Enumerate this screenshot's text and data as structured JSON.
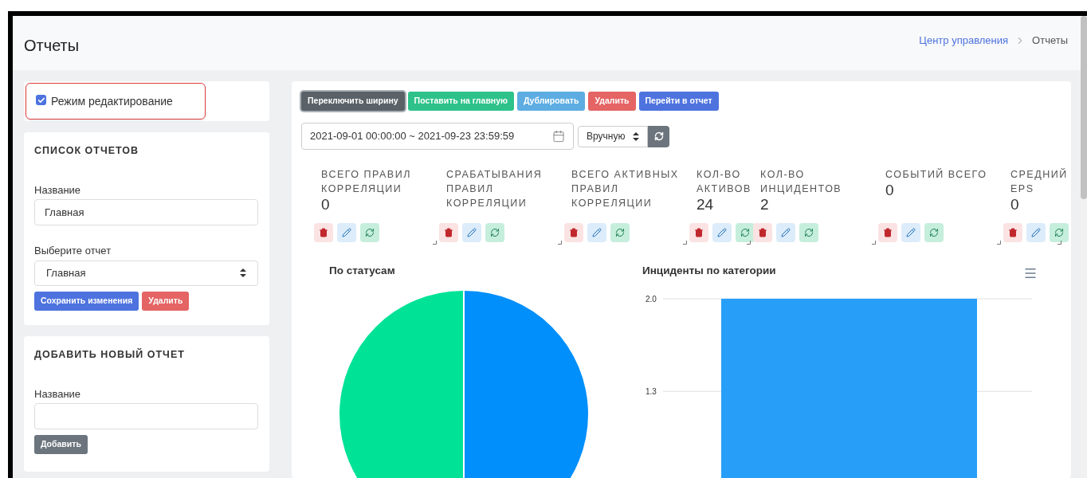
{
  "page": {
    "title": "Отчеты",
    "breadcrumb": [
      {
        "label": "Центр управления",
        "link": true
      },
      {
        "label": "Отчеты",
        "link": false
      }
    ]
  },
  "edit_mode": {
    "label": "Режим редактирование",
    "checked": true
  },
  "report_list": {
    "heading": "СПИСОК ОТЧЕТОВ",
    "name_label": "Название",
    "name_value": "Главная",
    "select_label": "Выберите отчет",
    "select_value": "Главная",
    "buttons": [
      {
        "label": "Сохранить изменения",
        "kind": "primary"
      },
      {
        "label": "Удалить",
        "kind": "danger"
      }
    ]
  },
  "new_report": {
    "heading": "ДОБАВИТЬ НОВЫЙ ОТЧЕТ",
    "name_label": "Название",
    "button": "Добавить"
  },
  "toolbar": [
    {
      "label": "Переключить ширину",
      "kind": "dark"
    },
    {
      "label": "Поставить на главную",
      "kind": "success"
    },
    {
      "label": "Дублировать",
      "kind": "info"
    },
    {
      "label": "Удалить",
      "kind": "danger"
    },
    {
      "label": "Перейти в отчет",
      "kind": "primary"
    }
  ],
  "date_range": "2021-09-01 00:00:00 ~ 2021-09-23 23:59:59",
  "refresh_mode": "Вручную",
  "widgets": [
    {
      "title": "ВСЕГО ПРАВИЛ КОРРЕЛЯЦИИ",
      "value": "0"
    },
    {
      "title": "СРАБАТЫВАНИЯ ПРАВИЛ КОРРЕЛЯЦИИ"
    },
    {
      "title": "ВСЕГО АКТИВНЫХ ПРАВИЛ КОРРЕЛЯЦИИ"
    },
    {
      "title": "КОЛ-ВО АКТИВОВ",
      "value": "24"
    },
    {
      "title": "КОЛ-ВО ИНЦИДЕНТОВ",
      "value": "2"
    },
    {
      "title": "СОБЫТИЙ ВСЕГО",
      "value": "0"
    },
    {
      "title": "СРЕДНИЙ EPS",
      "value": "0"
    }
  ],
  "pie": {
    "title": "По статусам"
  },
  "bar": {
    "title": "Инциденты по категории",
    "chart_data": {
      "type": "bar",
      "yticks": [
        {
          "value": 2,
          "label": "2.0"
        },
        {
          "value": 1.3,
          "label": "1.3"
        }
      ],
      "ylim": [
        0,
        2
      ],
      "series": [
        {
          "color": "#279ff9",
          "values": [
            2
          ]
        }
      ]
    }
  }
}
